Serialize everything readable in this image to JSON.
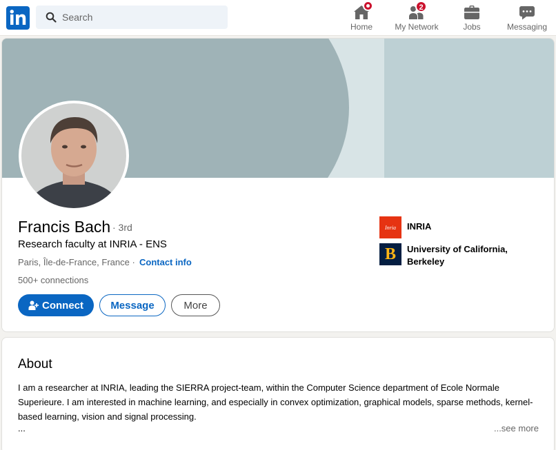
{
  "nav": {
    "search_placeholder": "Search",
    "items": [
      {
        "label": "Home",
        "icon": "home-icon",
        "badge": ""
      },
      {
        "label": "My Network",
        "icon": "network-icon",
        "badge": "2"
      },
      {
        "label": "Jobs",
        "icon": "briefcase-icon",
        "badge": ""
      },
      {
        "label": "Messaging",
        "icon": "messaging-icon",
        "badge": ""
      }
    ]
  },
  "profile": {
    "name": "Francis Bach",
    "degree": "· 3rd",
    "headline": "Research faculty at INRIA - ENS",
    "location": "Paris, Île-de-France, France ·",
    "contact_label": "Contact info",
    "connections": "500+ connections",
    "buttons": {
      "connect": "Connect",
      "message": "Message",
      "more": "More"
    },
    "organizations": [
      {
        "name": "INRIA",
        "logo_text": "Inria"
      },
      {
        "name": "University of California, Berkeley",
        "logo_text": "B"
      }
    ]
  },
  "about": {
    "title": "About",
    "text": "I am a researcher at INRIA, leading the SIERRA project-team, within the Computer Science department of Ecole Normale Superieure. I am interested in machine learning, and especially in convex optimization, graphical models, sparse methods, kernel-based learning, vision and signal processing.",
    "ellipsis": "...",
    "see_more": "...see more"
  },
  "colors": {
    "brand": "#0a66c2",
    "badge": "#cb112d",
    "inria": "#e63312",
    "berkeley_blue": "#041e42",
    "berkeley_gold": "#fdb515"
  }
}
